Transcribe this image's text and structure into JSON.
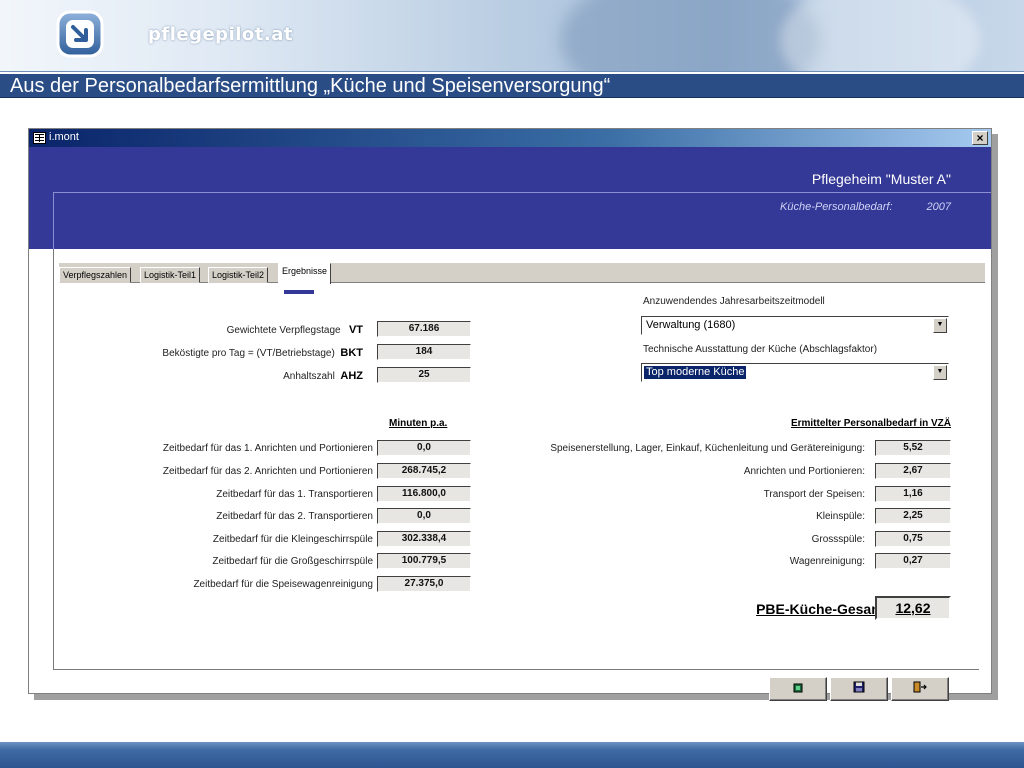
{
  "banner": {
    "brand": "pflegepilot.at",
    "slide_title": "Aus der Personalbedarfsermittlung „Küche und Speisenversorgung“"
  },
  "window": {
    "title": "i.mont",
    "close_label": "×"
  },
  "header": {
    "facility": "Pflegeheim \"Muster A\"",
    "subtitle": "Küche-Personalbedarf:",
    "year": "2007"
  },
  "tabs": [
    {
      "label": "Verpflegszahlen",
      "active": false
    },
    {
      "label": "Logistik-Teil1",
      "active": false
    },
    {
      "label": "Logistik-Teil2",
      "active": false
    },
    {
      "label": "Ergebnisse",
      "active": true
    }
  ],
  "top_fields": [
    {
      "label": "Gewichtete Verpflegstage",
      "code": "VT",
      "value": "67.186"
    },
    {
      "label": "Beköstigte pro Tag = (VT/Betriebstage)",
      "code": "BKT",
      "value": "184"
    },
    {
      "label": "Anhaltszahl",
      "code": "AHZ",
      "value": "25"
    }
  ],
  "settings": {
    "model_label": "Anzuwendendes Jahresarbeitszeitmodell",
    "model_value": "Verwaltung (1680)",
    "equipment_label": "Technische Ausstattung der Küche (Abschlagsfaktor)",
    "equipment_value": "Top moderne Küche"
  },
  "minutes": {
    "header": "Minuten p.a.",
    "rows": [
      {
        "label": "Zeitbedarf für das 1. Anrichten und Portionieren",
        "value": "0,0"
      },
      {
        "label": "Zeitbedarf für das 2. Anrichten und Portionieren",
        "value": "268.745,2"
      },
      {
        "label": "Zeitbedarf für das 1. Transportieren",
        "value": "116.800,0"
      },
      {
        "label": "Zeitbedarf für das 2. Transportieren",
        "value": "0,0"
      },
      {
        "label": "Zeitbedarf für die Kleingeschirrspüle",
        "value": "302.338,4"
      },
      {
        "label": "Zeitbedarf für die Großgeschirrspüle",
        "value": "100.779,5"
      },
      {
        "label": "Zeitbedarf für die Speisewagenreinigung",
        "value": "27.375,0"
      }
    ]
  },
  "staff": {
    "header": "Ermittelter Personalbedarf in VZÄ",
    "rows": [
      {
        "label": "Speisenerstellung, Lager, Einkauf, Küchenleitung und Gerätereinigung:",
        "value": "5,52"
      },
      {
        "label": "Anrichten und Portionieren:",
        "value": "2,67"
      },
      {
        "label": "Transport der Speisen:",
        "value": "1,16"
      },
      {
        "label": "Kleinspüle:",
        "value": "2,25"
      },
      {
        "label": "Grossspüle:",
        "value": "0,75"
      },
      {
        "label": "Wagenreinigung:",
        "value": "0,27"
      }
    ],
    "total_label": "PBE-Küche-Gesamt:",
    "total_value": "12,62"
  },
  "icons": {
    "buttons": [
      "record-icon",
      "save-disk-icon",
      "exit-door-icon"
    ]
  },
  "colors": {
    "header_blue": "#343896",
    "title_bar_blue": "#2b4d86",
    "selection": "#0a246a"
  }
}
